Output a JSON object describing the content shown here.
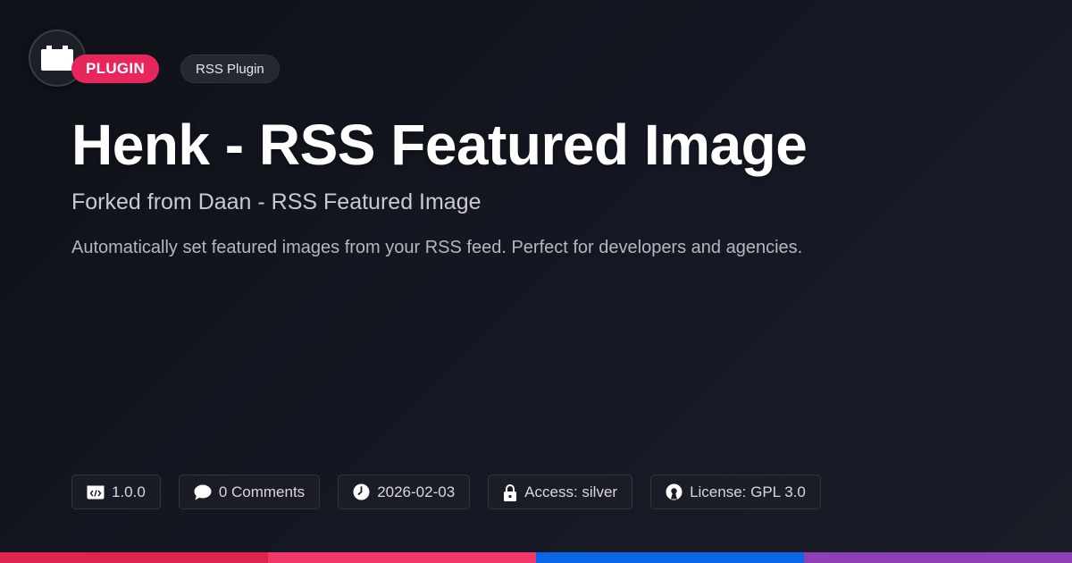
{
  "header": {
    "logo_icon": "plugin-block-icon",
    "type_badge": "PLUGIN",
    "category_badge": "RSS Plugin"
  },
  "main": {
    "title": "Henk - RSS Featured Image",
    "subtitle": "Forked from Daan - RSS Featured Image",
    "description": "Automatically set featured images from your RSS feed. Perfect for developers and agencies."
  },
  "meta": {
    "version": {
      "icon": "code-icon",
      "label": "1.0.0"
    },
    "comments": {
      "icon": "comment-icon",
      "label": "0 Comments"
    },
    "date": {
      "icon": "clock-icon",
      "label": "2026-02-03"
    },
    "access": {
      "icon": "lock-icon",
      "label": "Access: silver"
    },
    "license": {
      "icon": "open-source-icon",
      "label": "License: GPL 3.0"
    }
  },
  "colors": {
    "accent": "#e8265b",
    "stripe": [
      "#e0224f",
      "#f2386a",
      "#0a66e6",
      "#8e3fb3"
    ]
  }
}
